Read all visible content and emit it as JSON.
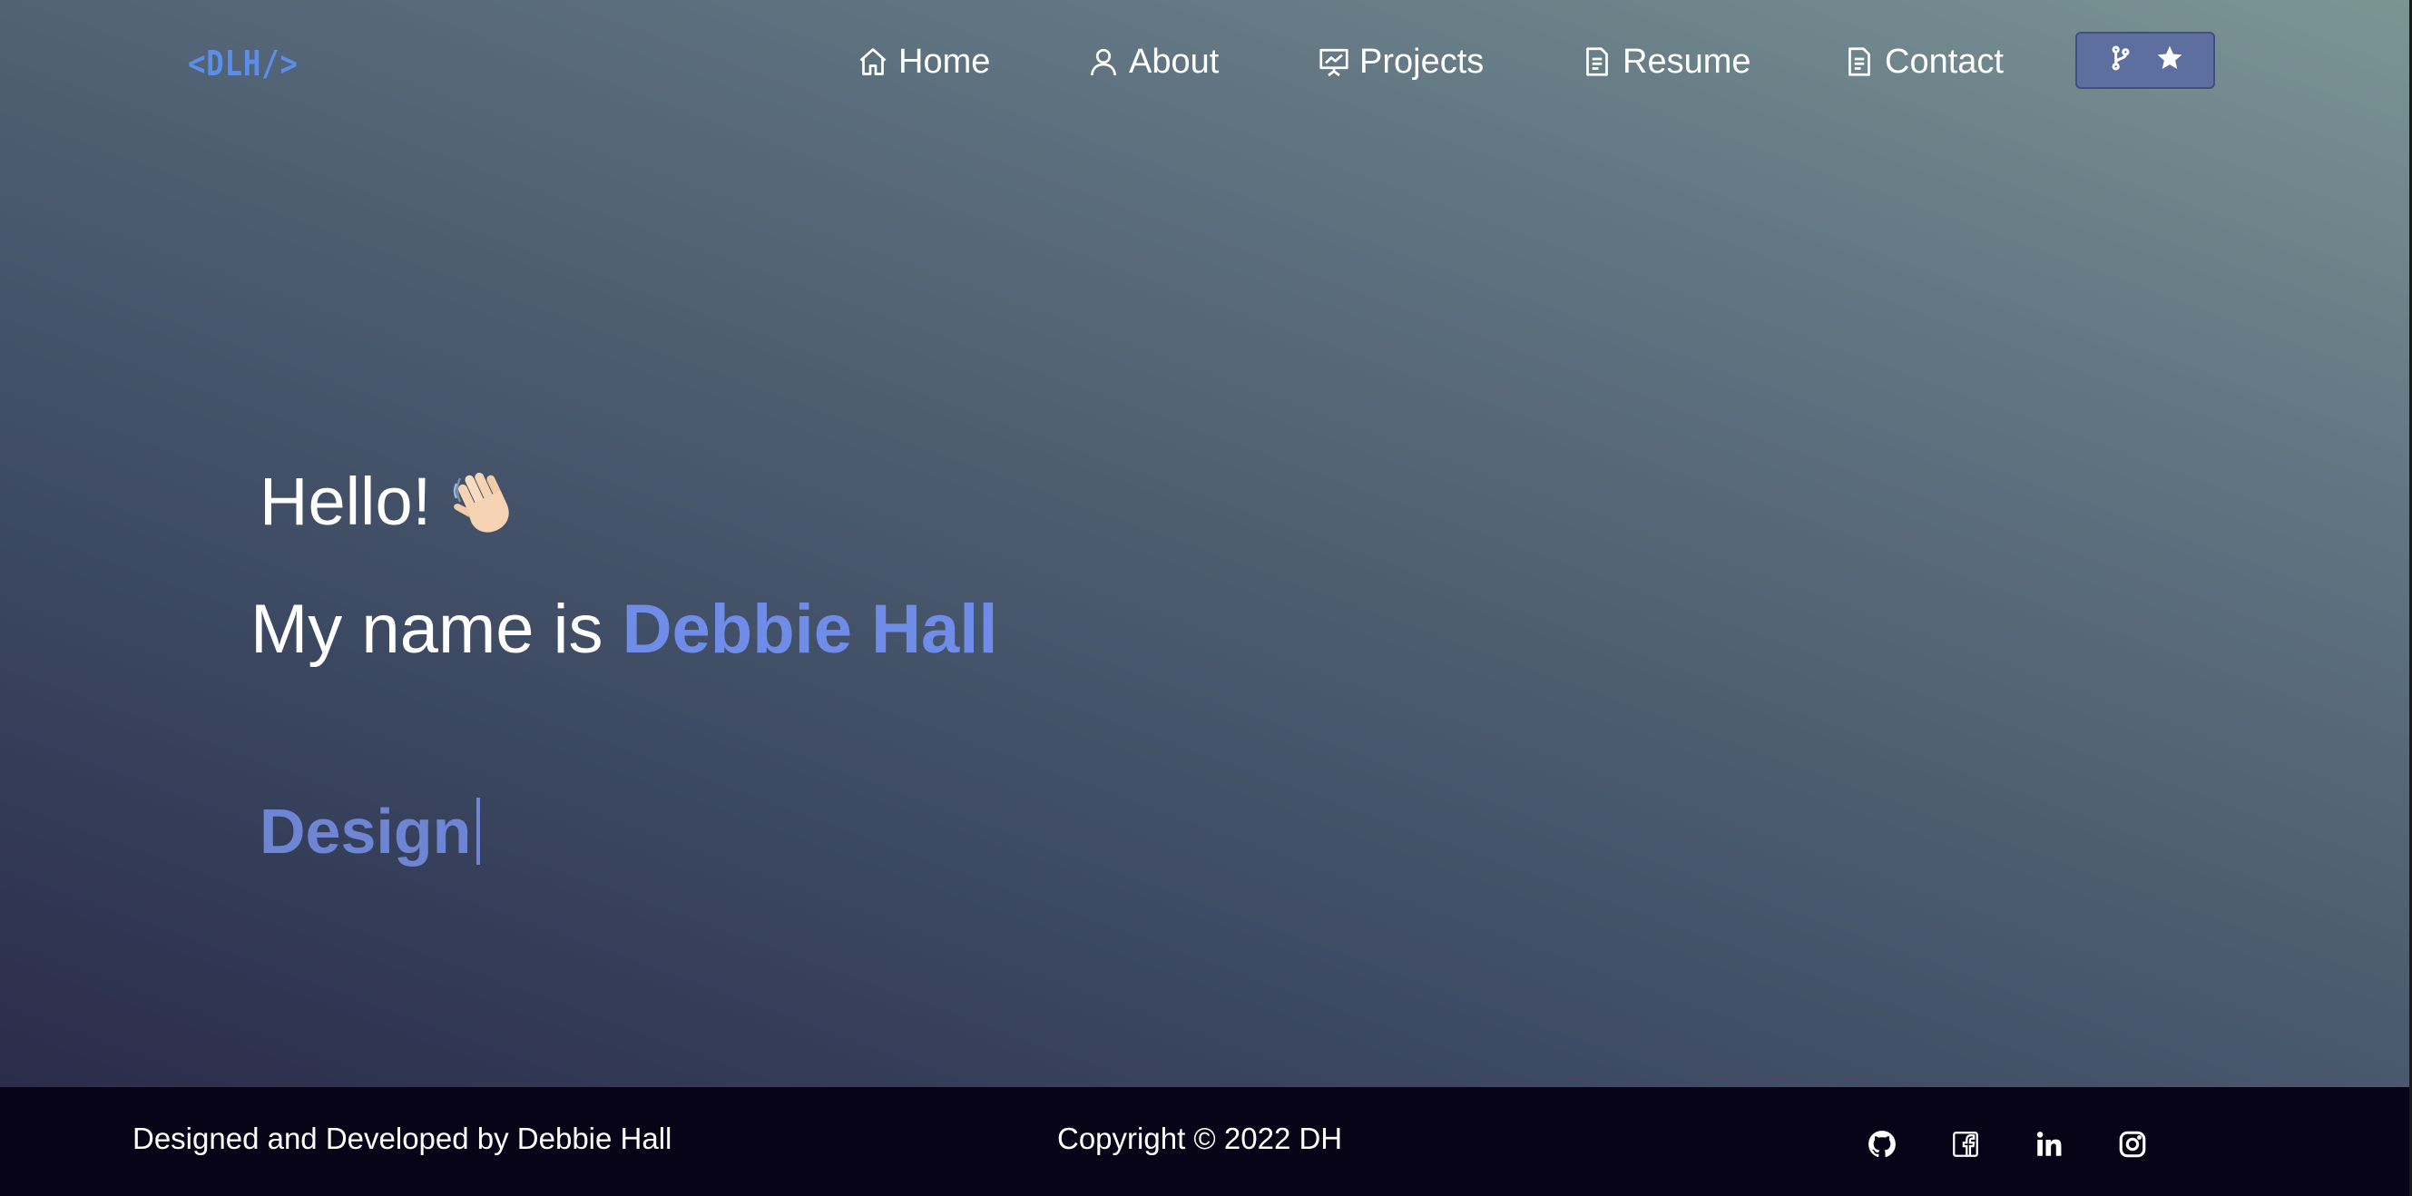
{
  "header": {
    "logo": "<DLH/>",
    "nav": [
      {
        "label": "Home",
        "icon": "home-icon"
      },
      {
        "label": "About",
        "icon": "user-icon"
      },
      {
        "label": "Projects",
        "icon": "presentation-icon"
      },
      {
        "label": "Resume",
        "icon": "document-icon"
      },
      {
        "label": "Contact",
        "icon": "document-icon"
      }
    ],
    "fork_button": {
      "icons": [
        "git-fork-icon",
        "star-icon"
      ]
    }
  },
  "hero": {
    "greeting": "Hello!",
    "greeting_icon": "waving-hand-icon",
    "intro_prefix": "My name is ",
    "name": "Debbie Hall",
    "typed_text": "Design"
  },
  "footer": {
    "credit": "Designed and Developed by Debbie Hall",
    "copyright": "Copyright © 2022 DH",
    "social": [
      "github-icon",
      "facebook-icon",
      "linkedin-icon",
      "instagram-icon"
    ]
  },
  "colors": {
    "accent": "#6f8de8",
    "logo": "#5b8ee6",
    "footer_bg": "#080418",
    "button_bg": "#5d6f9e"
  }
}
